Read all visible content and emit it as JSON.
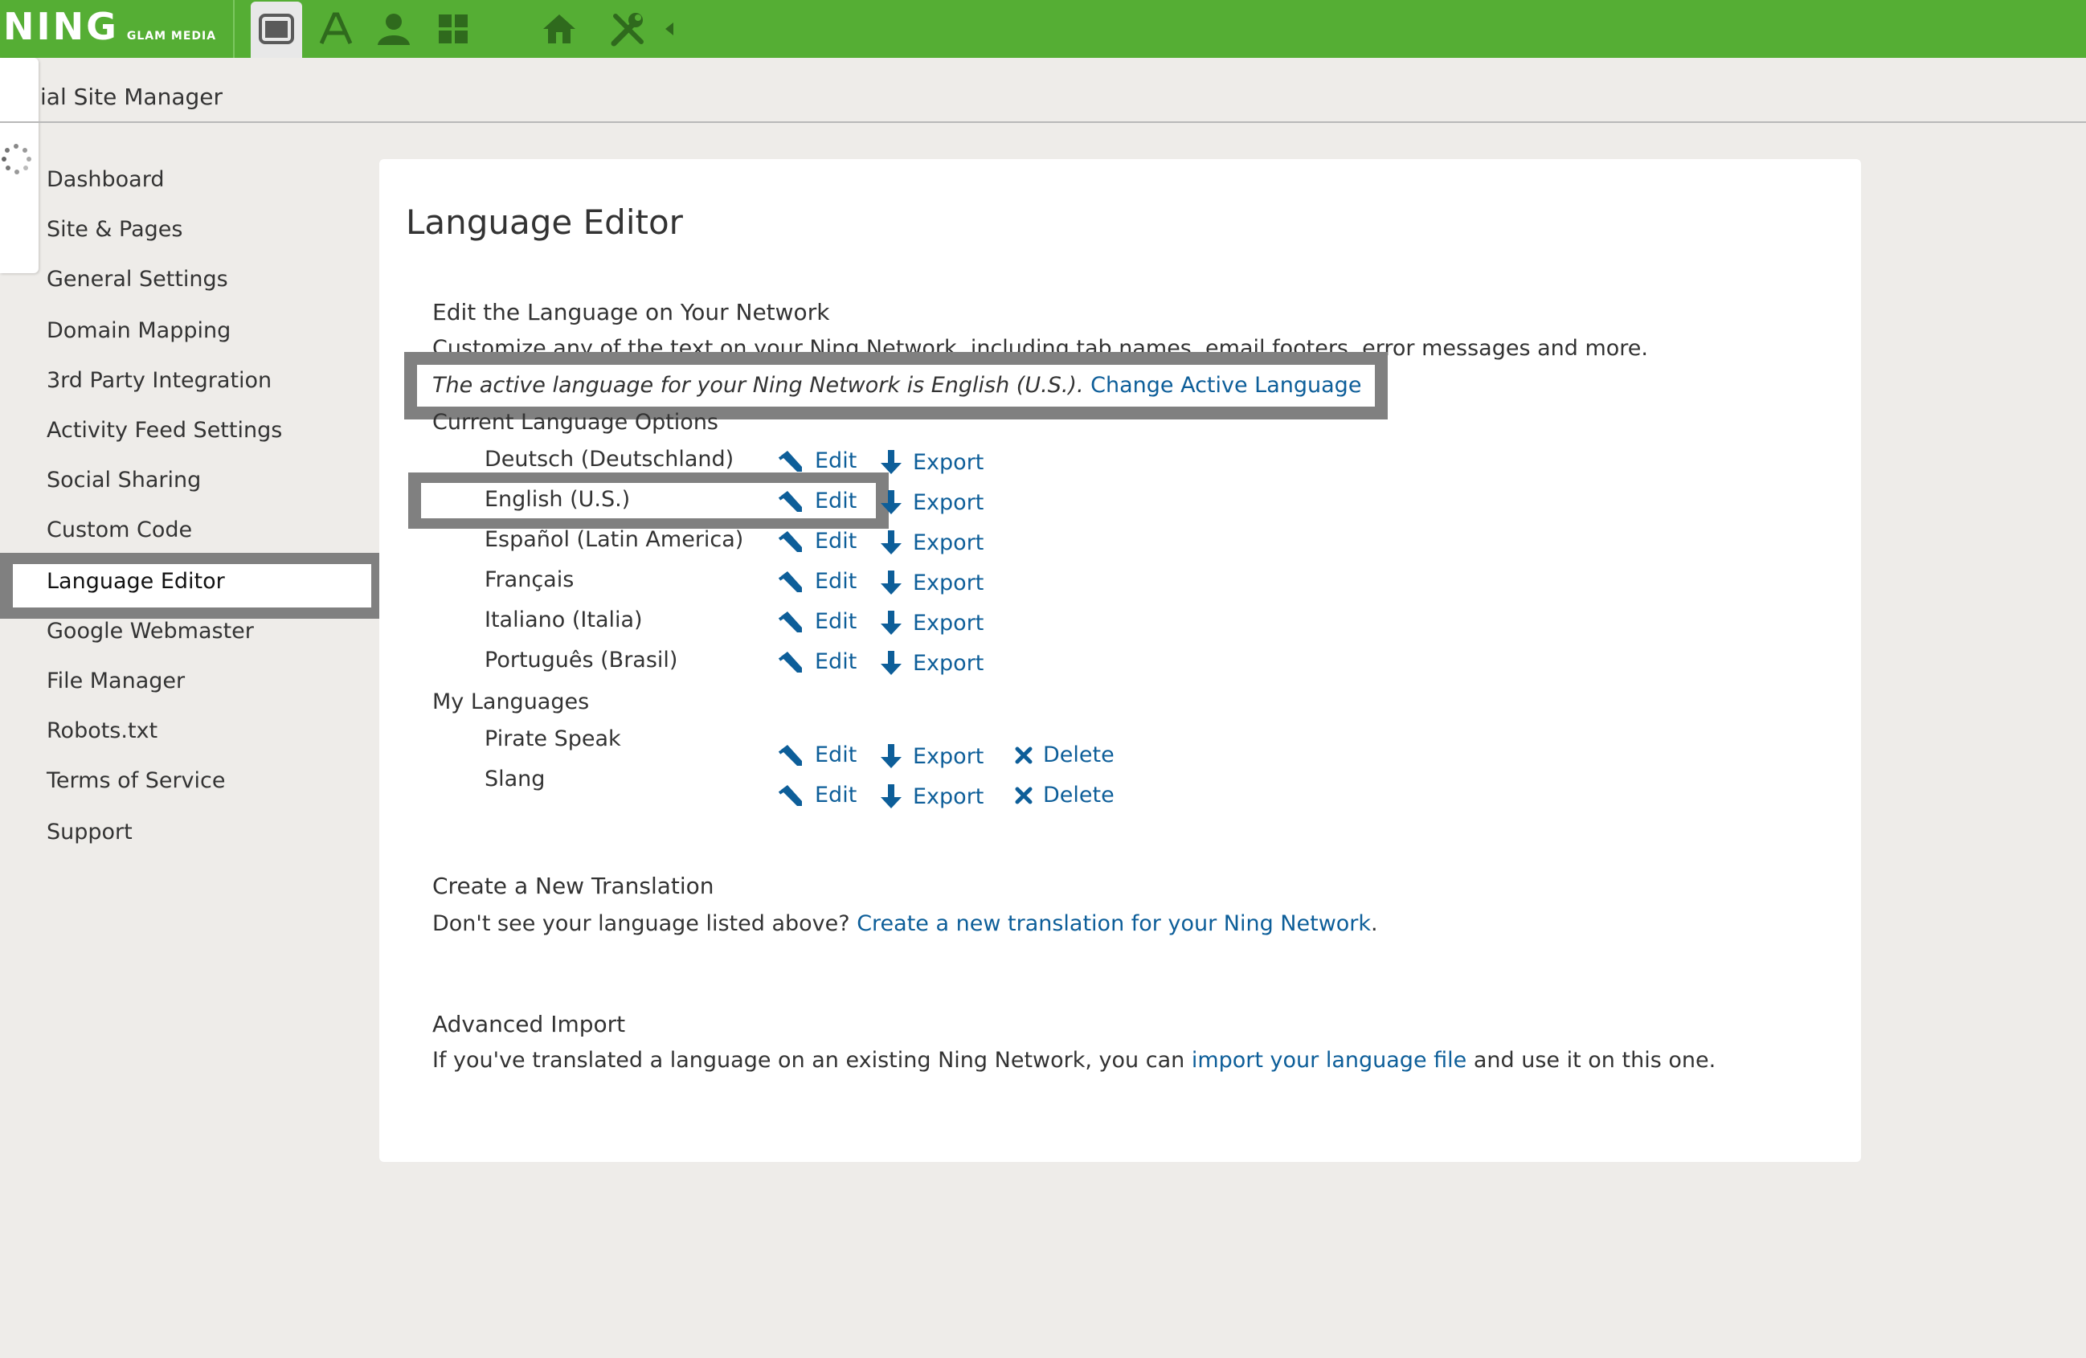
{
  "topbar": {
    "logo_main": "NING",
    "logo_sub": "GLAM MEDIA",
    "icons": [
      "window-icon",
      "font-icon",
      "person-icon",
      "grid-icon",
      "home-icon",
      "tools-icon"
    ]
  },
  "header": {
    "site_title": "ial Site Manager"
  },
  "sidebar": {
    "items": [
      {
        "label": "Dashboard"
      },
      {
        "label": "Site & Pages"
      },
      {
        "label": "General Settings"
      },
      {
        "label": "Domain Mapping"
      },
      {
        "label": "3rd Party Integration"
      },
      {
        "label": "Activity Feed Settings"
      },
      {
        "label": "Social Sharing"
      },
      {
        "label": "Custom Code"
      },
      {
        "label": "Language Editor",
        "active": true
      },
      {
        "label": "Google Webmaster"
      },
      {
        "label": "File Manager"
      },
      {
        "label": "Robots.txt"
      },
      {
        "label": "Terms of Service"
      },
      {
        "label": "Support"
      }
    ]
  },
  "main": {
    "title": "Language Editor",
    "edit_section": {
      "heading": "Edit the Language on Your Network",
      "description": "Customize any of the text on your Ning Network, including tab names, email footers, error messages and more.",
      "active_text": "The active language for your Ning Network is English (U.S.).",
      "change_link": "Change Active Language"
    },
    "current_options": {
      "heading": "Current Language Options",
      "languages": [
        {
          "name": "Deutsch (Deutschland)"
        },
        {
          "name": "English (U.S.)"
        },
        {
          "name": "Español (Latin America)"
        },
        {
          "name": "Français"
        },
        {
          "name": "Italiano (Italia)"
        },
        {
          "name": "Português (Brasil)"
        }
      ]
    },
    "my_languages": {
      "heading": "My Languages",
      "languages": [
        {
          "name": "Pirate Speak"
        },
        {
          "name": "Slang"
        }
      ]
    },
    "actions": {
      "edit": "Edit",
      "export": "Export",
      "delete": "Delete"
    },
    "create_section": {
      "heading": "Create a New Translation",
      "text": "Don't see your language listed above?",
      "link": "Create a new translation for your Ning Network",
      "suffix": "."
    },
    "import_section": {
      "heading": "Advanced Import",
      "text": "If you've translated a language on an existing Ning Network, you can",
      "link": "import your language file",
      "suffix": "and use it on this one."
    }
  },
  "colors": {
    "topbar": "#55ae34",
    "link": "#0d5e99",
    "background": "#eeece9",
    "highlight_frame": "#808080"
  }
}
